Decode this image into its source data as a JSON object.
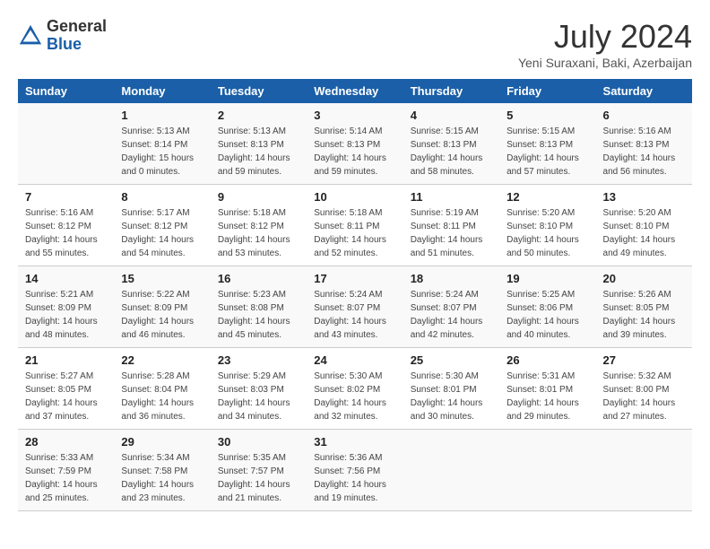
{
  "header": {
    "logo_general": "General",
    "logo_blue": "Blue",
    "month_title": "July 2024",
    "location": "Yeni Suraxani, Baki, Azerbaijan"
  },
  "weekdays": [
    "Sunday",
    "Monday",
    "Tuesday",
    "Wednesday",
    "Thursday",
    "Friday",
    "Saturday"
  ],
  "weeks": [
    [
      {
        "day": "",
        "info": ""
      },
      {
        "day": "1",
        "info": "Sunrise: 5:13 AM\nSunset: 8:14 PM\nDaylight: 15 hours\nand 0 minutes."
      },
      {
        "day": "2",
        "info": "Sunrise: 5:13 AM\nSunset: 8:13 PM\nDaylight: 14 hours\nand 59 minutes."
      },
      {
        "day": "3",
        "info": "Sunrise: 5:14 AM\nSunset: 8:13 PM\nDaylight: 14 hours\nand 59 minutes."
      },
      {
        "day": "4",
        "info": "Sunrise: 5:15 AM\nSunset: 8:13 PM\nDaylight: 14 hours\nand 58 minutes."
      },
      {
        "day": "5",
        "info": "Sunrise: 5:15 AM\nSunset: 8:13 PM\nDaylight: 14 hours\nand 57 minutes."
      },
      {
        "day": "6",
        "info": "Sunrise: 5:16 AM\nSunset: 8:13 PM\nDaylight: 14 hours\nand 56 minutes."
      }
    ],
    [
      {
        "day": "7",
        "info": "Sunrise: 5:16 AM\nSunset: 8:12 PM\nDaylight: 14 hours\nand 55 minutes."
      },
      {
        "day": "8",
        "info": "Sunrise: 5:17 AM\nSunset: 8:12 PM\nDaylight: 14 hours\nand 54 minutes."
      },
      {
        "day": "9",
        "info": "Sunrise: 5:18 AM\nSunset: 8:12 PM\nDaylight: 14 hours\nand 53 minutes."
      },
      {
        "day": "10",
        "info": "Sunrise: 5:18 AM\nSunset: 8:11 PM\nDaylight: 14 hours\nand 52 minutes."
      },
      {
        "day": "11",
        "info": "Sunrise: 5:19 AM\nSunset: 8:11 PM\nDaylight: 14 hours\nand 51 minutes."
      },
      {
        "day": "12",
        "info": "Sunrise: 5:20 AM\nSunset: 8:10 PM\nDaylight: 14 hours\nand 50 minutes."
      },
      {
        "day": "13",
        "info": "Sunrise: 5:20 AM\nSunset: 8:10 PM\nDaylight: 14 hours\nand 49 minutes."
      }
    ],
    [
      {
        "day": "14",
        "info": "Sunrise: 5:21 AM\nSunset: 8:09 PM\nDaylight: 14 hours\nand 48 minutes."
      },
      {
        "day": "15",
        "info": "Sunrise: 5:22 AM\nSunset: 8:09 PM\nDaylight: 14 hours\nand 46 minutes."
      },
      {
        "day": "16",
        "info": "Sunrise: 5:23 AM\nSunset: 8:08 PM\nDaylight: 14 hours\nand 45 minutes."
      },
      {
        "day": "17",
        "info": "Sunrise: 5:24 AM\nSunset: 8:07 PM\nDaylight: 14 hours\nand 43 minutes."
      },
      {
        "day": "18",
        "info": "Sunrise: 5:24 AM\nSunset: 8:07 PM\nDaylight: 14 hours\nand 42 minutes."
      },
      {
        "day": "19",
        "info": "Sunrise: 5:25 AM\nSunset: 8:06 PM\nDaylight: 14 hours\nand 40 minutes."
      },
      {
        "day": "20",
        "info": "Sunrise: 5:26 AM\nSunset: 8:05 PM\nDaylight: 14 hours\nand 39 minutes."
      }
    ],
    [
      {
        "day": "21",
        "info": "Sunrise: 5:27 AM\nSunset: 8:05 PM\nDaylight: 14 hours\nand 37 minutes."
      },
      {
        "day": "22",
        "info": "Sunrise: 5:28 AM\nSunset: 8:04 PM\nDaylight: 14 hours\nand 36 minutes."
      },
      {
        "day": "23",
        "info": "Sunrise: 5:29 AM\nSunset: 8:03 PM\nDaylight: 14 hours\nand 34 minutes."
      },
      {
        "day": "24",
        "info": "Sunrise: 5:30 AM\nSunset: 8:02 PM\nDaylight: 14 hours\nand 32 minutes."
      },
      {
        "day": "25",
        "info": "Sunrise: 5:30 AM\nSunset: 8:01 PM\nDaylight: 14 hours\nand 30 minutes."
      },
      {
        "day": "26",
        "info": "Sunrise: 5:31 AM\nSunset: 8:01 PM\nDaylight: 14 hours\nand 29 minutes."
      },
      {
        "day": "27",
        "info": "Sunrise: 5:32 AM\nSunset: 8:00 PM\nDaylight: 14 hours\nand 27 minutes."
      }
    ],
    [
      {
        "day": "28",
        "info": "Sunrise: 5:33 AM\nSunset: 7:59 PM\nDaylight: 14 hours\nand 25 minutes."
      },
      {
        "day": "29",
        "info": "Sunrise: 5:34 AM\nSunset: 7:58 PM\nDaylight: 14 hours\nand 23 minutes."
      },
      {
        "day": "30",
        "info": "Sunrise: 5:35 AM\nSunset: 7:57 PM\nDaylight: 14 hours\nand 21 minutes."
      },
      {
        "day": "31",
        "info": "Sunrise: 5:36 AM\nSunset: 7:56 PM\nDaylight: 14 hours\nand 19 minutes."
      },
      {
        "day": "",
        "info": ""
      },
      {
        "day": "",
        "info": ""
      },
      {
        "day": "",
        "info": ""
      }
    ]
  ]
}
